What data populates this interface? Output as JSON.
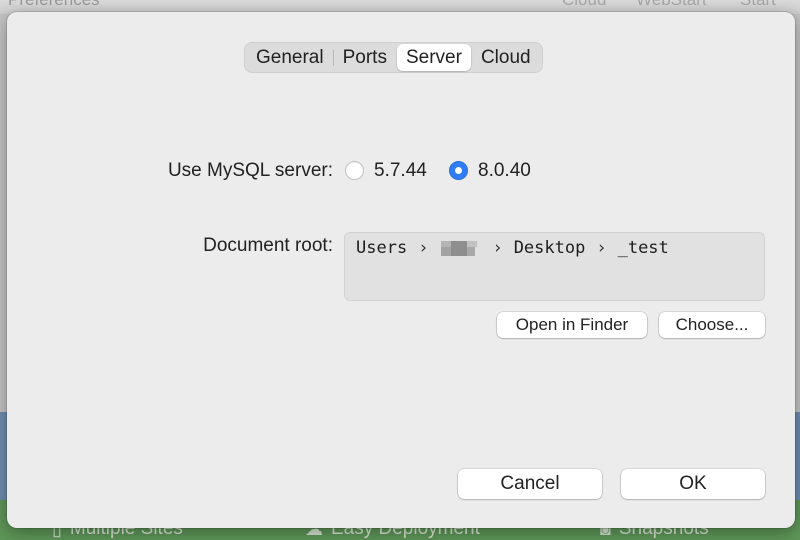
{
  "background": {
    "title_left": "Preferences",
    "title_right": [
      "Cloud",
      "WebStart",
      "Start"
    ],
    "features": [
      {
        "icon": "mosaic-icon",
        "label": "Multiple Sites"
      },
      {
        "icon": "cloud-upload-icon",
        "label": "Easy Deployment"
      },
      {
        "icon": "camera-icon",
        "label": "Snapshots"
      }
    ]
  },
  "tabs": [
    {
      "label": "General",
      "selected": false
    },
    {
      "label": "Ports",
      "selected": false
    },
    {
      "label": "Server",
      "selected": true
    },
    {
      "label": "Cloud",
      "selected": false
    }
  ],
  "mysql": {
    "label": "Use MySQL server:",
    "options": [
      {
        "label": "5.7.44",
        "selected": false
      },
      {
        "label": "8.0.40",
        "selected": true
      }
    ]
  },
  "document_root": {
    "label": "Document root:",
    "path_parts": [
      "Users",
      "Desktop",
      "_test"
    ],
    "path_separator": "›"
  },
  "buttons": {
    "open_in_finder": "Open in Finder",
    "choose": "Choose...",
    "cancel": "Cancel",
    "ok": "OK"
  },
  "colors": {
    "accent": "#2f7cf6",
    "sheet_bg": "#ececec"
  }
}
